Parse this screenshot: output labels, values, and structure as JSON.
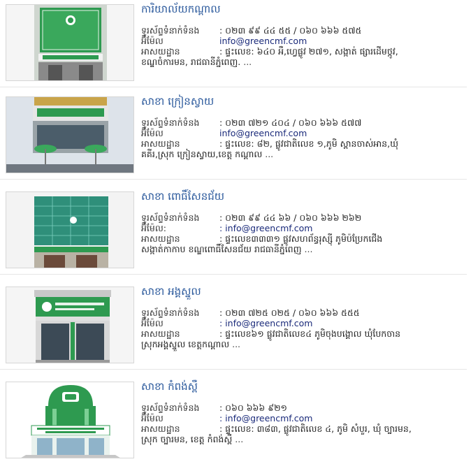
{
  "branches": [
    {
      "title": "ការិយាល័យកណ្តាល",
      "phone_label": "ទូរស័ព្ទទំនាក់ទំនង",
      "phone": ": ០២៣ ៩៩ ៤៤ ៥៥ / ០៦០ ៦៦៦ ៥៧៥",
      "email_label": "អ៊ីម៉ែល",
      "email": "info@greencmf.com",
      "address_label": "អាសយដ្ឋាន",
      "address_line1": ": ផ្ទះលេខ: ៦៤០ អឺ,ហ្វេផ្លូវ ២៧១, សង្កាត់ ផ្សារដើមថ្កូវ,",
      "address_line2": "ខណ្ឌចំការមន, រាជធានីភ្នំពេញ.",
      "ellipsis": "...",
      "thumb_icon": "building-photo-central-office"
    },
    {
      "title": "សាខា ក្រៀនស្វាយ",
      "phone_label": "ទូរស័ព្ទទំនាក់ទំនង",
      "phone": ": ០២៣ ៧២១ ៤០៤ / ០៦០ ៦៦៦ ៥៧៧",
      "email_label": "អ៊ីម៉ែល",
      "email": "info@greencmf.com",
      "address_label": "អាសយដ្ឋាន",
      "address_line1": ": ផ្ទះលេខ: ៨២, ផ្លូវជាតិលេខ ១,ភូមិ ស្ពានចាស់អាន,ឃុំ",
      "address_line2": "គគីរ,ស្រុក ក្រៀនស្វាយ,ខេត្ត កណ្តាល",
      "ellipsis": "...",
      "thumb_icon": "building-photo-kien-svay"
    },
    {
      "title": "សាខា ពោធិ៍សែនជ័យ",
      "phone_label": "ទូរស័ព្ទទំនាក់ទំនង",
      "phone": ": ០២៣ ៩៩ ៤៤ ៦៦ / ០៦០ ៦៦៦ ២៦២",
      "email_label": "អ៊ីម៉ែល:",
      "email": ": info@greencmf.com",
      "address_label": "អាសយដ្ឋាន",
      "address_line1": ": ផ្ទះលេខ៣៣៣១ ផ្លូវសហព័ន្ធរុស្ស៊ី ភូមិប៉ប្រែកជើង",
      "address_line2": "សង្កាត់កាកាប ខណ្ឌពោធិ៍សែនជ័យ រាជធានីភ្នំពេញ",
      "ellipsis": "...",
      "thumb_icon": "building-photo-pou-senchey"
    },
    {
      "title": "សាខា អង្គស្នួល",
      "phone_label": "ទូរស័ព្ទទំនាក់ទំនង",
      "phone": ": ០២៣ ៧២៥ ០២៥ / ០៦០ ៦៦៦ ៥៥៥",
      "email_label": "អ៊ីម៉ែល",
      "email": ": info@greencmf.com",
      "address_label": "អាសយដ្ឋាន",
      "address_line1": ": ផ្ទះលេខ៦១ ផ្លូវជាតិលេខ៤ ភូមិចុងបង្គោល ឃុំបែកចាន",
      "address_line2": "ស្រុកអង្គស្នួល ខេត្តកណ្តាល",
      "ellipsis": "...",
      "thumb_icon": "building-photo-ang-snuol"
    },
    {
      "title": "សាខា កំពង់ស្ពឺ",
      "phone_label": "ទូរស័ព្ទទំនាក់ទំនង",
      "phone": ": ០៦០ ៦៦៦ ៩២១",
      "email_label": "អ៊ីម៉ែល",
      "email": ": info@greencmf.com",
      "address_label": "អាសយដ្ឋាន",
      "address_line1": ": ផ្ទះលេខ: ៣៨៣, ផ្លូវជាតិលេខ ៤, ភូមិ សំបួរ, ឃុំ ច្បារមន,",
      "address_line2": "ស្រុក ច្បារមន, ខេត្ត កំពង់ស្ពឺ",
      "ellipsis": "...",
      "thumb_icon": "building-illustration-kampong-speu"
    }
  ],
  "colors": {
    "title": "#27569a",
    "brand_green": "#2e9a50",
    "email": "#1a2a7a"
  }
}
